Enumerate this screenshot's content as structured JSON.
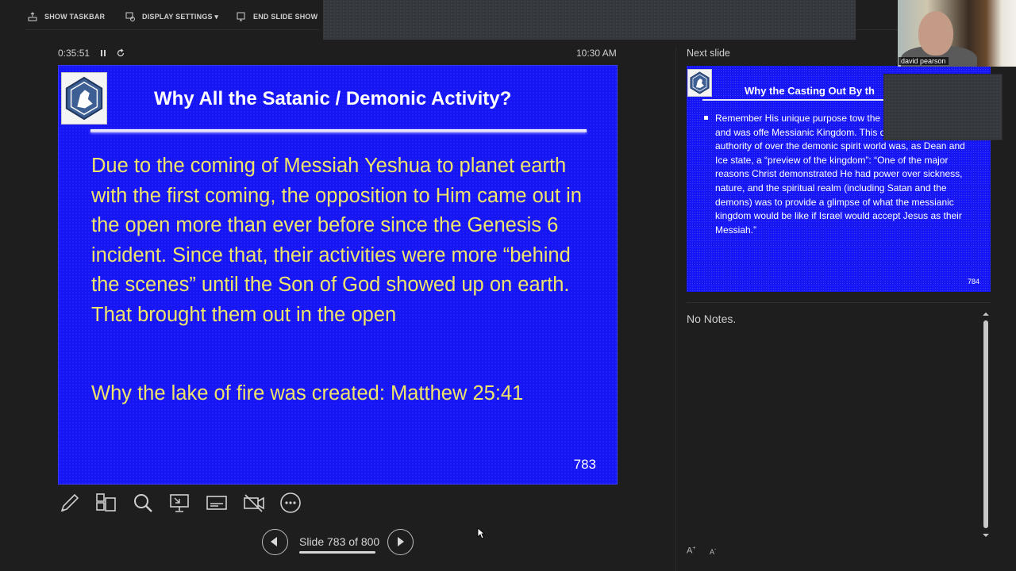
{
  "toolbar": {
    "show_taskbar": "SHOW TASKBAR",
    "display_settings": "DISPLAY SETTINGS ▾",
    "end_slide_show": "END SLIDE SHOW"
  },
  "presenter": {
    "elapsed_time": "0:35:51",
    "clock": "10:30 AM"
  },
  "current_slide": {
    "title": "Why All the Satanic / Demonic Activity?",
    "body": "Due to the coming of Messiah Yeshua to planet earth with the first coming, the opposition to Him came out in the open more than ever before since the Genesis 6 incident. Since that, their activities were more “behind the scenes” until the Son of God showed up on earth. That brought them out in the open",
    "body2": "Why the lake of fire was created: Matthew 25:41",
    "number": "783"
  },
  "tools": [
    "pen-icon",
    "slide-grid-icon",
    "zoom-icon",
    "pointer-screen-icon",
    "subtitles-icon",
    "camera-off-icon",
    "more-options-icon"
  ],
  "navigation": {
    "slide_count": "Slide 783 of 800"
  },
  "next_slide": {
    "label": "Next slide",
    "title": "Why the Casting Out By th",
    "body": "Remember His unique purpose tow the promised Messiah and was offe Messianic Kingdom. This demonstration of His authority of over the demonic spirit world was, as Dean and Ice state, a “preview of the kingdom”: “One of the major reasons Christ demonstrated He had power over sickness, nature, and the spiritual realm (including Satan and the demons) was to provide a glimpse of what the messianic kingdom would be like if Israel would accept Jesus as their Messiah.”",
    "number": "784"
  },
  "notes": {
    "text": "No Notes.",
    "increase_font": "A",
    "decrease_font": "A"
  },
  "webcam": {
    "name": "david pearson"
  },
  "colors": {
    "slide_bg": "#1515f5",
    "slide_body_text": "#f0e46a",
    "app_bg": "#1e1e1e"
  }
}
